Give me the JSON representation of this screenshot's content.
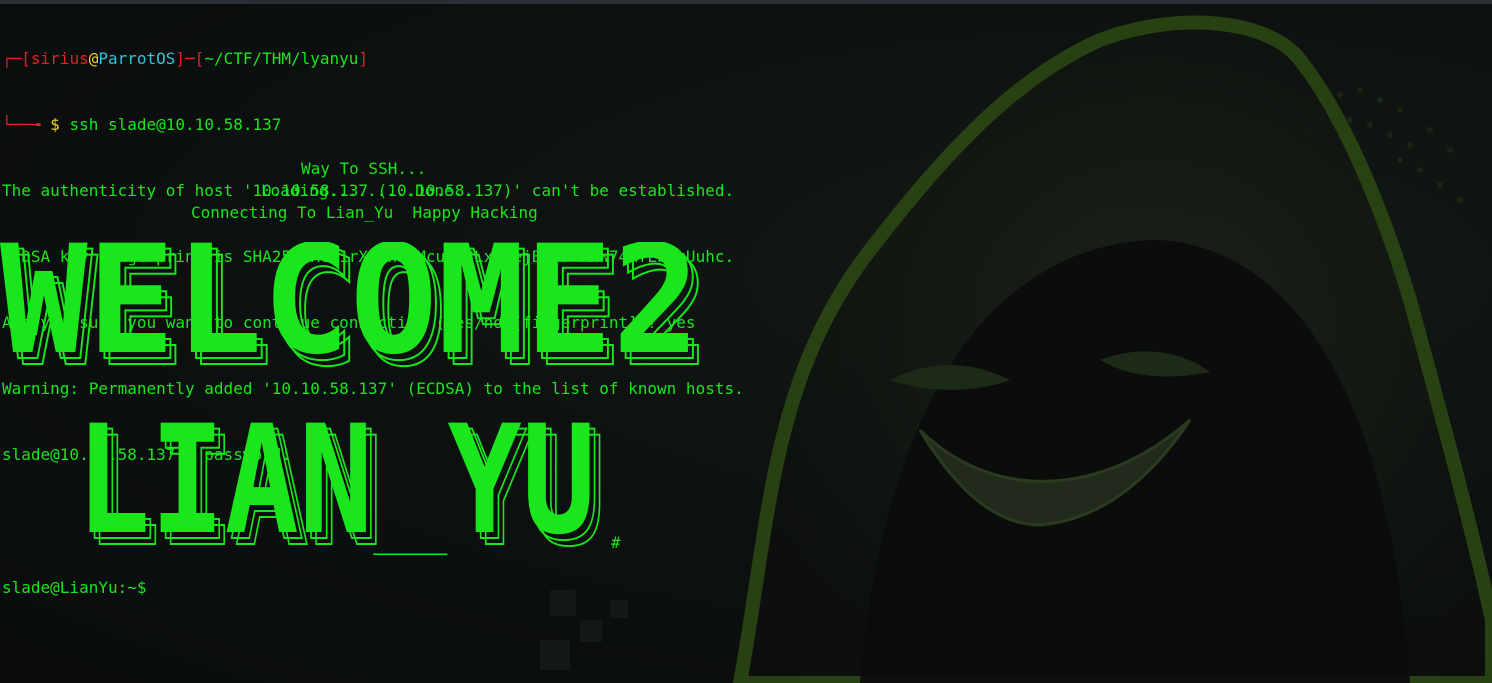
{
  "prompt": {
    "user": "sirius",
    "at": "@",
    "host": "ParrotOS",
    "path": "~/CTF/THM/lyanyu",
    "dollar": "$",
    "command": "ssh slade@10.10.58.137"
  },
  "output": [
    "The authenticity of host '10.10.58.137 (10.10.58.137)' can't be established.",
    "ECDSA key fingerprint is SHA256:Rc91rXUKn9aMcuwG8LxCUejBAjP+xNW74MfLbPqUuhc.",
    "Are you sure you want to continue connecting (yes/no/[fingerprint])? yes",
    "Warning: Permanently added '10.10.58.137' (ECDSA) to the list of known hosts.",
    "slade@10.10.58.137's password:"
  ],
  "banner": {
    "line1": "Way To SSH...",
    "line2": "Loading.........Done..",
    "line3": "Connecting To Lian_Yu  Happy Hacking",
    "art_line1": "WELCOME2",
    "art_line2": "LIAN_YU",
    "hash": "#"
  },
  "remote_prompt": "slade@LianYu:~$",
  "colors": {
    "terminal_green": "#19e61b",
    "prompt_red": "#e02222",
    "host_cyan": "#36c3d8",
    "background": "#0b0e10"
  }
}
